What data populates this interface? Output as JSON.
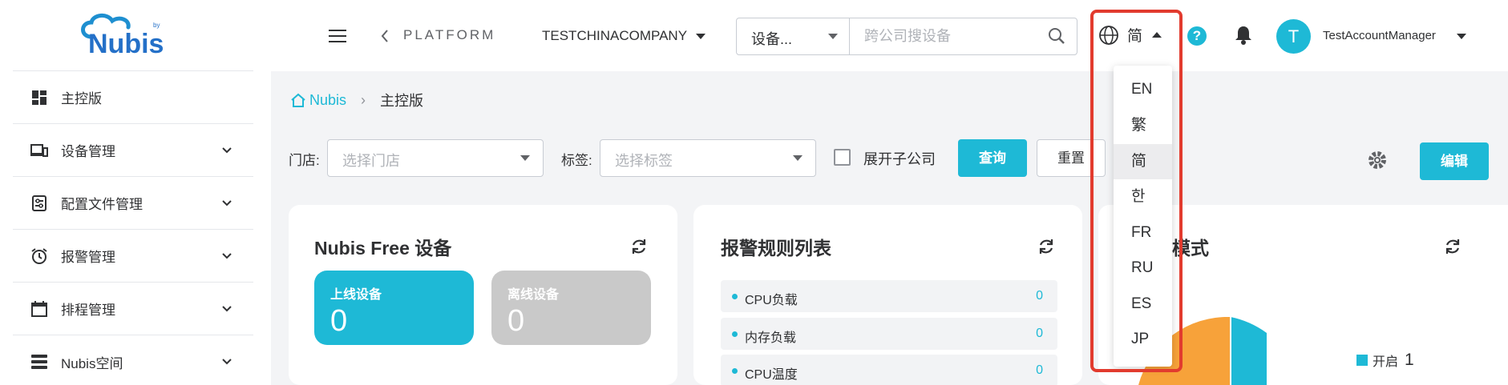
{
  "brand": {
    "logo_text": "Nubis",
    "logo_small": "by"
  },
  "sidebar": {
    "items": [
      {
        "label": "主控版",
        "icon": "dashboard-icon",
        "expandable": false
      },
      {
        "label": "设备管理",
        "icon": "devices-icon",
        "expandable": true
      },
      {
        "label": "配置文件管理",
        "icon": "config-file-icon",
        "expandable": true
      },
      {
        "label": "报警管理",
        "icon": "alarm-clock-icon",
        "expandable": true
      },
      {
        "label": "排程管理",
        "icon": "calendar-icon",
        "expandable": true
      },
      {
        "label": "Nubis空间",
        "icon": "storage-icon",
        "expandable": true
      }
    ]
  },
  "header": {
    "platform": "PLATFORM",
    "company": "TESTCHINACOMPANY",
    "search": {
      "category": "设备...",
      "placeholder": "跨公司搜设备"
    },
    "language_current": "简",
    "user": {
      "initial": "T",
      "name": "TestAccountManager"
    }
  },
  "breadcrumb": {
    "home": "Nubis",
    "current": "主控版"
  },
  "filters": {
    "store_label": "门店:",
    "store_placeholder": "选择门店",
    "tag_label": "标签:",
    "tag_placeholder": "选择标签",
    "expand_label": "展开子公司",
    "expand_checked": false,
    "query_label": "查询",
    "reset_label": "重置",
    "edit_label": "编辑"
  },
  "cards": {
    "free_devices": {
      "title": "Nubis Free 设备",
      "online": {
        "label": "上线设备",
        "value": "0"
      },
      "offline": {
        "label": "离线设备",
        "value": "0"
      }
    },
    "alarm_rules": {
      "title": "报警规则列表",
      "rows": [
        {
          "name": "CPU负载",
          "value": "0"
        },
        {
          "name": "内存负载",
          "value": "0"
        },
        {
          "name": "CPU温度",
          "value": "0"
        }
      ]
    },
    "mode": {
      "title_visible": "模式",
      "legend": [
        {
          "label": "开启",
          "value": "1"
        }
      ]
    }
  },
  "language_dropdown": {
    "options": [
      "EN",
      "繁",
      "简",
      "한",
      "FR",
      "RU",
      "ES",
      "JP"
    ],
    "selected": "简"
  },
  "colors": {
    "accent": "#1eb9d6",
    "offline": "#c9c9c9",
    "highlight": "#e23b2e",
    "chart_orange": "#f7a23a"
  }
}
